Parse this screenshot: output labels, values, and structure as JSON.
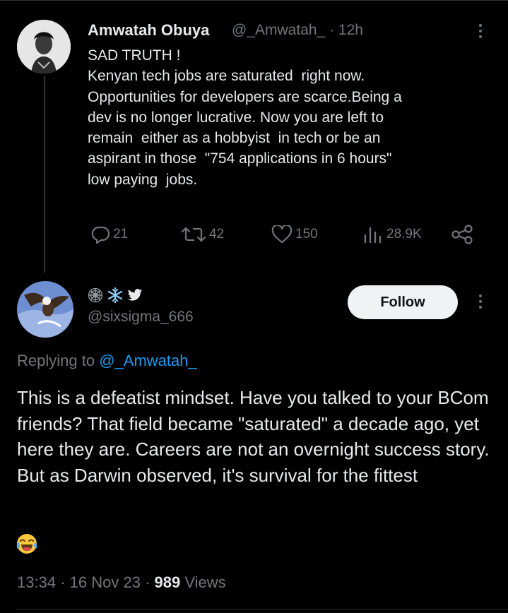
{
  "tweet": {
    "author_name": "Amwatah Obuya",
    "handle": "@_Amwatah_",
    "separator": "·",
    "time": "12h",
    "text": "SAD TRUTH !\nKenyan tech jobs are saturated  right now.\nOpportunities for developers are scarce.Being a\ndev is no longer lucrative. Now you are left to\nremain  either as a hobbyist  in tech or be an\naspirant in those  \"754 applications in 6 hours\"\nlow paying  jobs.",
    "replies": "21",
    "reposts": "42",
    "likes": "150",
    "views": "28.9K"
  },
  "reply": {
    "handle": "@sixsigma_666",
    "follow_label": "Follow",
    "replying_prefix": "Replying to",
    "replying_to": "@_Amwatah_",
    "text": "This is a defeatist mindset. Have you talked to your BCom friends? That field became \"saturated\" a decade ago, yet here they are. Careers are not an overnight success story.  But as Darwin observed, it's survival for the fittest",
    "time": "13:34",
    "date": "16 Nov 23",
    "views_count": "989",
    "views_label": "Views"
  },
  "colors": {
    "background": "#000000",
    "text": "#e7e9ea",
    "muted": "#71767b",
    "link": "#1d9bf0",
    "follow_bg": "#eff3f4"
  },
  "icons": [
    "reply-icon",
    "repost-icon",
    "heart-icon",
    "views-chart-icon",
    "share-icon",
    "more-icon",
    "spiderweb-emoji",
    "snowflake-emoji",
    "twitter-bird-icon",
    "laughing-tears-emoji"
  ]
}
